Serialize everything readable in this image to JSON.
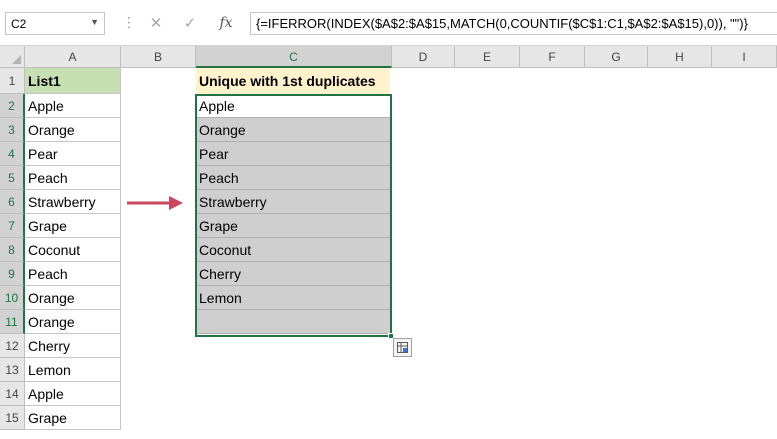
{
  "formula_bar": {
    "name_box": "C2",
    "cancel_icon": "✕",
    "enter_icon": "✓",
    "fx_icon": "fx",
    "formula": "{=IFERROR(INDEX($A$2:$A$15,MATCH(0,COUNTIF($C$1:C1,$A$2:$A$15),0)), \"\")}"
  },
  "columns": [
    "A",
    "B",
    "C",
    "D",
    "E",
    "F",
    "G",
    "H",
    "I"
  ],
  "rows": [
    "1",
    "2",
    "3",
    "4",
    "5",
    "6",
    "7",
    "8",
    "9",
    "10",
    "11",
    "12",
    "13",
    "14",
    "15"
  ],
  "column_a": [
    "List1",
    "Apple",
    "Orange",
    "Pear",
    "Peach",
    "Strawberry",
    "Grape",
    "Coconut",
    "Peach",
    "Orange",
    "Orange",
    "Cherry",
    "Lemon",
    "Apple",
    "Grape"
  ],
  "column_c": [
    "Unique with 1st duplicates",
    "Apple",
    "Orange",
    "Pear",
    "Peach",
    "Strawberry",
    "Grape",
    "Coconut",
    "Cherry",
    "Lemon",
    ""
  ],
  "colors": {
    "header_a_fill": "#c6e0b4",
    "header_c_fill": "#fff2cc",
    "selection_fill": "#cfcfcf",
    "selection_border": "#217346",
    "arrow": "#c9485b"
  }
}
